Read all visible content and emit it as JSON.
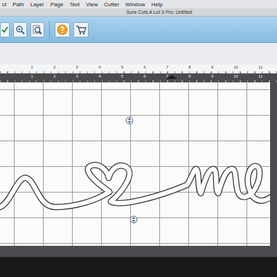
{
  "menu": [
    "ct",
    "Path",
    "Layer",
    "Page",
    "Text",
    "View",
    "Cutter",
    "Window",
    "Help"
  ],
  "window": {
    "title": "Sure Cuts A Lot 3 Pro: Untitled"
  },
  "top_ruler": [
    "1",
    "2",
    "3",
    "4",
    "5",
    "6",
    "7",
    "8",
    "9",
    "10",
    "11"
  ],
  "mat_ruler": [
    "1",
    "2",
    "3",
    "4",
    "5",
    "6",
    "7",
    "8",
    "9",
    "10",
    "11"
  ]
}
